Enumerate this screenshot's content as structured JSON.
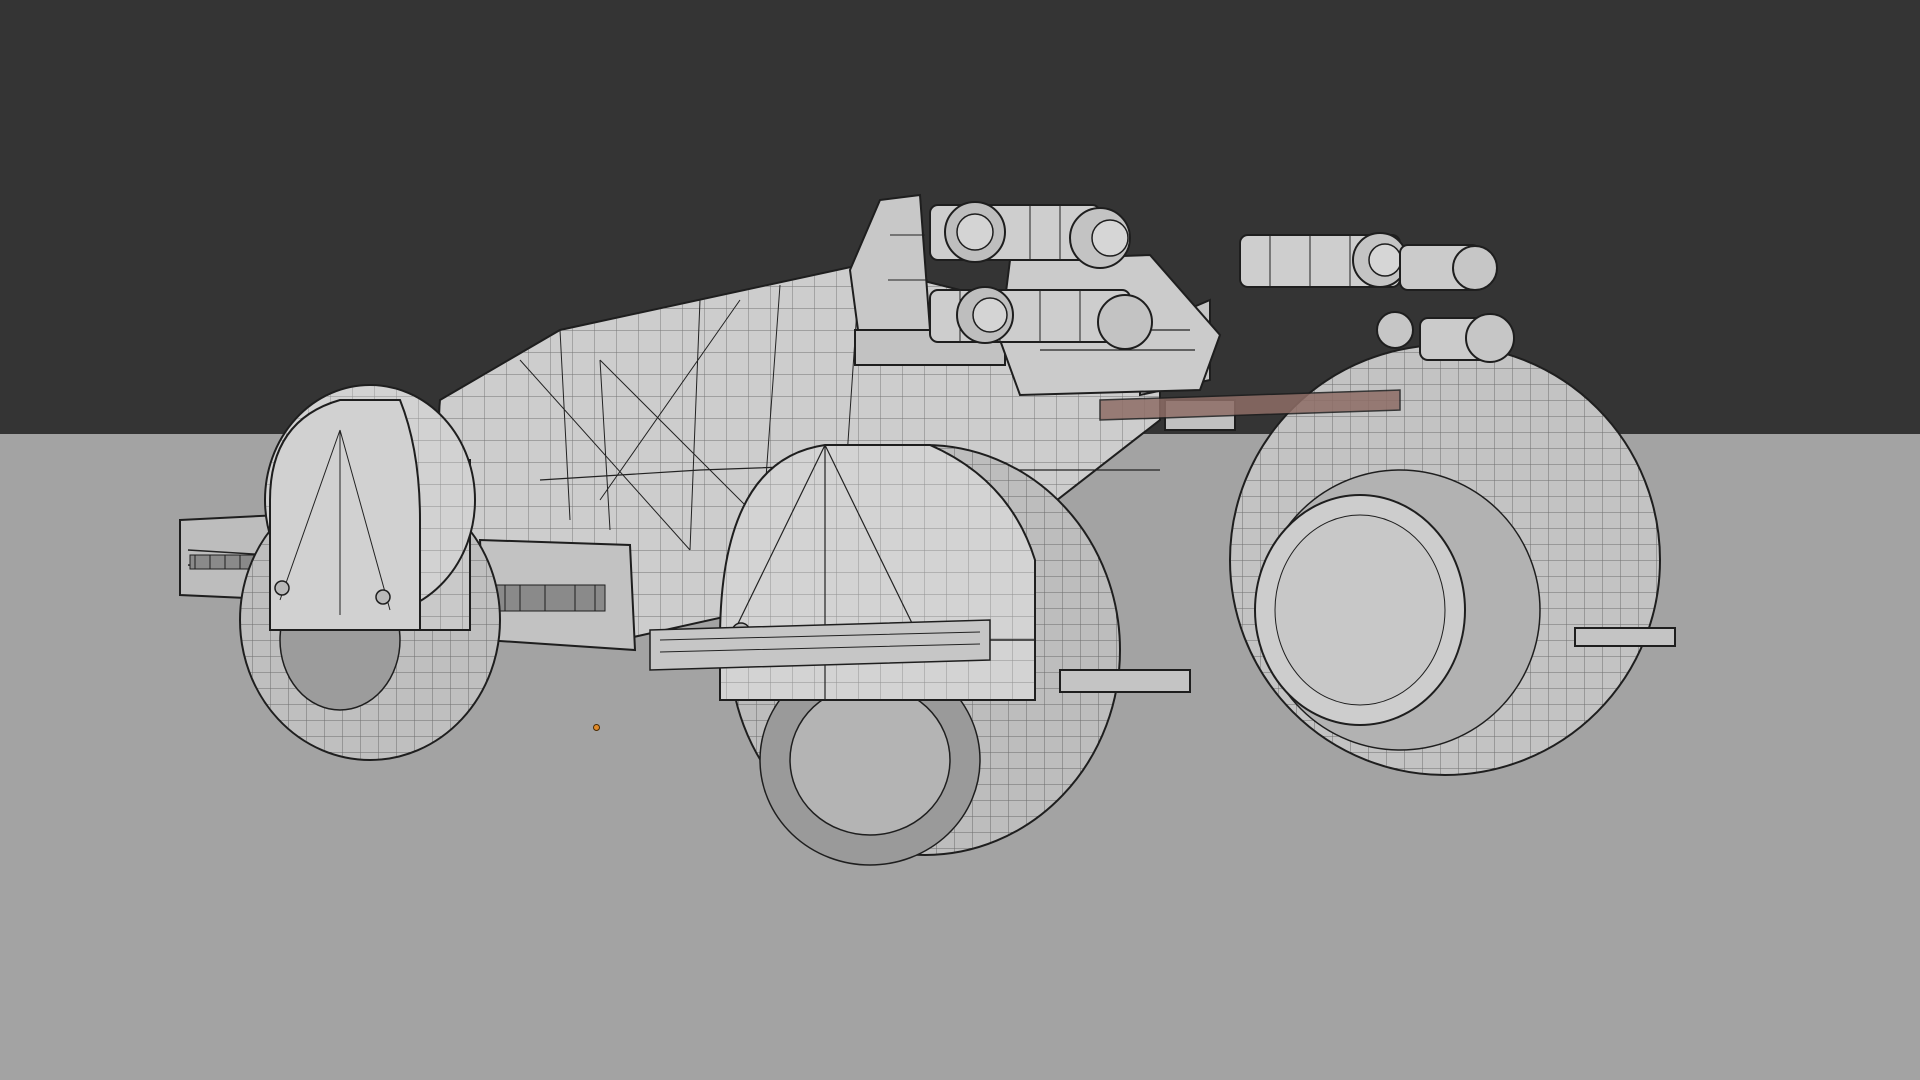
{
  "viewport": {
    "background_top": "#343434",
    "background_floor": "#a3a3a3"
  },
  "model": {
    "shading": "solid-wireframe",
    "wire_color": "#1e1e1e",
    "surface_color": "#c8c8c8",
    "surface_light": "#d6d6d6",
    "surface_dark": "#a9a9a9",
    "edge_accent": "#7a4a3a"
  },
  "origin_marker": {
    "color": "#e08a2a"
  }
}
